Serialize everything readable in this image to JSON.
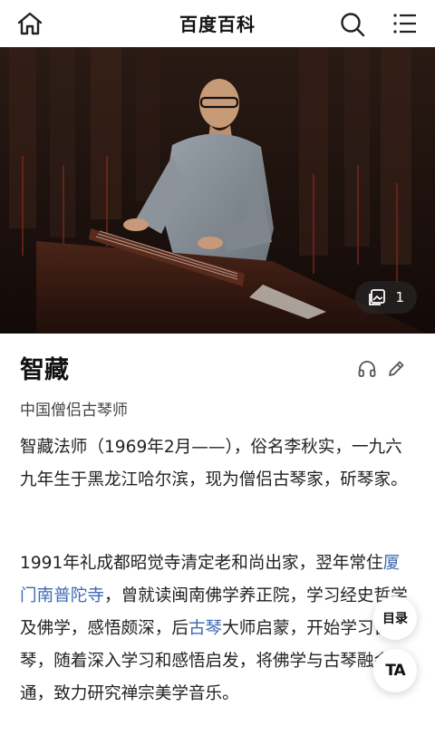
{
  "header": {
    "title": "百度百科",
    "home_icon": "home-icon",
    "search_icon": "search-icon",
    "menu_icon": "menu-icon"
  },
  "hero": {
    "photo_count": "1",
    "photo_icon": "gallery-icon"
  },
  "entry": {
    "title": "智藏",
    "subtitle": "中国僧侣古琴师",
    "audio_icon": "headphones-icon",
    "edit_icon": "edit-icon"
  },
  "content": {
    "p1": "智藏法师（1969年2月——），俗名李秋实，一九六九年生于黑龙江哈尔滨，现为僧侣古琴家，斫琴家。",
    "p2_a": "1991年礼成都昭觉寺清定老和尚出家，翌年常住",
    "p2_link1": "厦门南普陀寺",
    "p2_b": "，曾就读闽南佛学养正院，学习经史哲学及佛学，感悟颇深，后",
    "p2_link2": "古琴",
    "p2_c": "大师启蒙，开始学习古琴，随着深入学习和感悟启发，将佛学与古琴融会贯通，致力研究禅宗美学音乐。"
  },
  "floating": {
    "toc_label": "目录",
    "ta_label": "TA"
  },
  "colors": {
    "link": "#3e6ab3",
    "text": "#222222"
  }
}
